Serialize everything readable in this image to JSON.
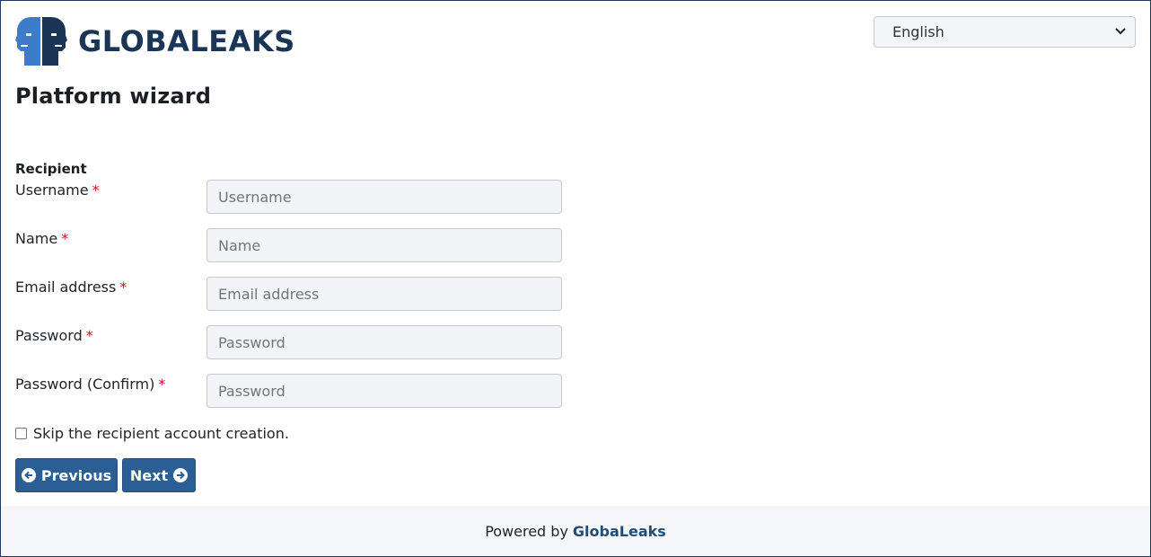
{
  "header": {
    "logo_text": "GLOBALEAKS",
    "language_select": {
      "selected": "English"
    }
  },
  "page": {
    "title": "Platform wizard",
    "section_label": "Recipient"
  },
  "form": {
    "required_marker": "*",
    "fields": [
      {
        "label": "Username",
        "placeholder": "Username",
        "value": ""
      },
      {
        "label": "Name",
        "placeholder": "Name",
        "value": ""
      },
      {
        "label": "Email address",
        "placeholder": "Email address",
        "value": ""
      },
      {
        "label": "Password",
        "placeholder": "Password",
        "value": ""
      },
      {
        "label": "Password (Confirm)",
        "placeholder": "Password",
        "value": ""
      }
    ],
    "skip_checkbox": {
      "label": "Skip the recipient account creation.",
      "checked": false
    }
  },
  "buttons": {
    "previous_label": "Previous",
    "next_label": "Next"
  },
  "footer": {
    "prefix": "Powered by",
    "brand": "GlobaLeaks"
  },
  "colors": {
    "primary": "#2a5e94",
    "brand_dark": "#1b3556",
    "brand_light": "#3d7cc9",
    "required": "#c0181f"
  },
  "icons": {
    "language": "chevron-down-icon",
    "previous": "arrow-circle-left-icon",
    "next": "arrow-circle-right-icon"
  }
}
